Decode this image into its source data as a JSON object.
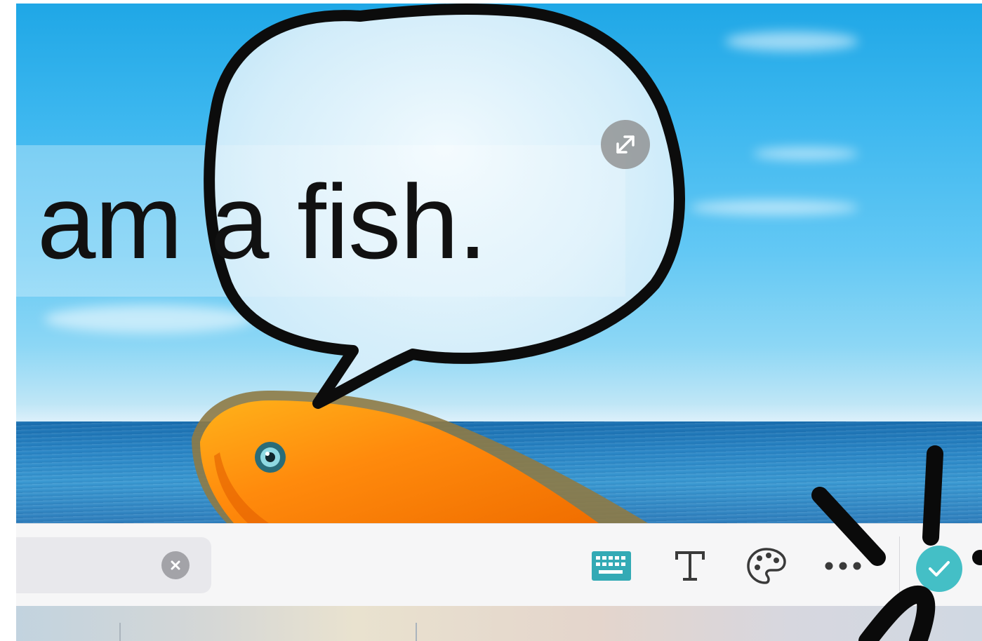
{
  "canvas": {
    "caption_text": "am a fish.",
    "resize_handle_icon": "resize-arrows-icon",
    "speech_bubble_icon": "speech-bubble-sticker",
    "fish_icon": "goldfish-sticker"
  },
  "toolbar": {
    "text_field_value": "",
    "clear_icon": "clear-x-icon",
    "tools": [
      {
        "name": "keyboard",
        "icon": "keyboard-icon",
        "active": true
      },
      {
        "name": "text-style",
        "icon": "text-format-icon"
      },
      {
        "name": "color",
        "icon": "palette-icon"
      },
      {
        "name": "more",
        "icon": "ellipsis-icon"
      }
    ],
    "done_icon": "checkmark-icon"
  },
  "colors": {
    "accent": "#44bfc6",
    "keyboard_active": "#33aab5",
    "toolbar_bg": "#f6f6f7",
    "text": "#111111"
  }
}
